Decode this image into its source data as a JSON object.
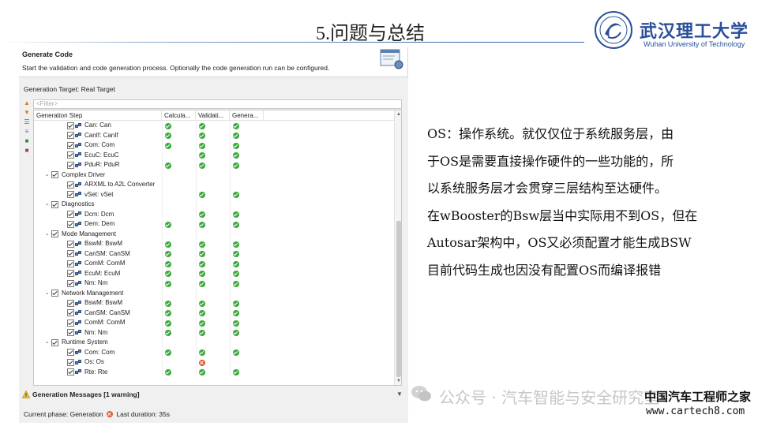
{
  "slide": {
    "title": "5.问题与总结",
    "logo_cn": "武汉理工大学",
    "logo_en": "Wuhan University of Technology"
  },
  "dialog": {
    "heading": "Generate Code",
    "description": "Start the validation and code generation process. Optionally the code generation run can be configured.",
    "generation_target": "Generation Target: Real Target",
    "filter_placeholder": "<Filter>",
    "columns": [
      "Generation Step",
      "Calcula...",
      "Validati...",
      "Genera..."
    ],
    "rows": [
      {
        "level": 2,
        "label": "Can: Can",
        "calc": "ok",
        "valid": "ok",
        "gen": "ok"
      },
      {
        "level": 2,
        "label": "CanIf: CanIf",
        "calc": "ok",
        "valid": "ok",
        "gen": "ok"
      },
      {
        "level": 2,
        "label": "Com: Com",
        "calc": "ok",
        "valid": "ok",
        "gen": "ok"
      },
      {
        "level": 2,
        "label": "EcuC: EcuC",
        "calc": "",
        "valid": "ok",
        "gen": "ok"
      },
      {
        "level": 2,
        "label": "PduR: PduR",
        "calc": "ok",
        "valid": "ok",
        "gen": "ok"
      },
      {
        "level": 1,
        "label": "Complex Driver",
        "calc": "",
        "valid": "",
        "gen": ""
      },
      {
        "level": 2,
        "label": "ARXML to A2L Converter",
        "calc": "",
        "valid": "",
        "gen": ""
      },
      {
        "level": 2,
        "label": "vSet: vSet",
        "calc": "",
        "valid": "ok",
        "gen": "ok"
      },
      {
        "level": 1,
        "label": "Diagnostics",
        "calc": "",
        "valid": "",
        "gen": ""
      },
      {
        "level": 2,
        "label": "Dcm: Dcm",
        "calc": "",
        "valid": "ok",
        "gen": "ok"
      },
      {
        "level": 2,
        "label": "Dem: Dem",
        "calc": "ok",
        "valid": "ok",
        "gen": "ok"
      },
      {
        "level": 1,
        "label": "Mode Management",
        "calc": "",
        "valid": "",
        "gen": ""
      },
      {
        "level": 2,
        "label": "BswM: BswM",
        "calc": "ok",
        "valid": "ok",
        "gen": "ok"
      },
      {
        "level": 2,
        "label": "CanSM: CanSM",
        "calc": "ok",
        "valid": "ok",
        "gen": "ok"
      },
      {
        "level": 2,
        "label": "ComM: ComM",
        "calc": "ok",
        "valid": "ok",
        "gen": "ok"
      },
      {
        "level": 2,
        "label": "EcuM: EcuM",
        "calc": "ok",
        "valid": "ok",
        "gen": "ok"
      },
      {
        "level": 2,
        "label": "Nm: Nm",
        "calc": "ok",
        "valid": "ok",
        "gen": "ok"
      },
      {
        "level": 1,
        "label": "Network Management",
        "calc": "",
        "valid": "",
        "gen": ""
      },
      {
        "level": 2,
        "label": "BswM: BswM",
        "calc": "ok",
        "valid": "ok",
        "gen": "ok"
      },
      {
        "level": 2,
        "label": "CanSM: CanSM",
        "calc": "ok",
        "valid": "ok",
        "gen": "ok"
      },
      {
        "level": 2,
        "label": "ComM: ComM",
        "calc": "ok",
        "valid": "ok",
        "gen": "ok"
      },
      {
        "level": 2,
        "label": "Nm: Nm",
        "calc": "ok",
        "valid": "ok",
        "gen": "ok"
      },
      {
        "level": 1,
        "label": "Runtime System",
        "calc": "",
        "valid": "",
        "gen": ""
      },
      {
        "level": 2,
        "label": "Com: Com",
        "calc": "ok",
        "valid": "ok",
        "gen": "ok"
      },
      {
        "level": 2,
        "label": "Os: Os",
        "calc": "",
        "valid": "err",
        "gen": ""
      },
      {
        "level": 2,
        "label": "Rte: Rte",
        "calc": "ok",
        "valid": "ok",
        "gen": "ok"
      }
    ],
    "messages_label": "Generation Messages [1 warning]",
    "phase_prefix": "Current phase: Generation",
    "phase_suffix": "Last duration: 35s"
  },
  "note_lines": [
    "OS：操作系统。就仅仅位于系统服务层，由",
    "于OS是需要直接操作硬件的一些功能的，所",
    "以系统服务层才会贯穿三层结构至达硬件。",
    "在wBooster的Bsw层当中实际用不到OS，但在",
    "Autosar架构中，OS又必须配置才能生成BSW",
    "目前代码生成也因没有配置OS而编译报错"
  ],
  "watermark": {
    "channel": "公众号 · 汽车智能与安全研究室",
    "brand": "中国汽车工程师之家",
    "url": "www.cartech8.com"
  },
  "colors": {
    "ok": "#3aa93a",
    "err": "#e0552b",
    "accent": "#2a4f9a"
  }
}
